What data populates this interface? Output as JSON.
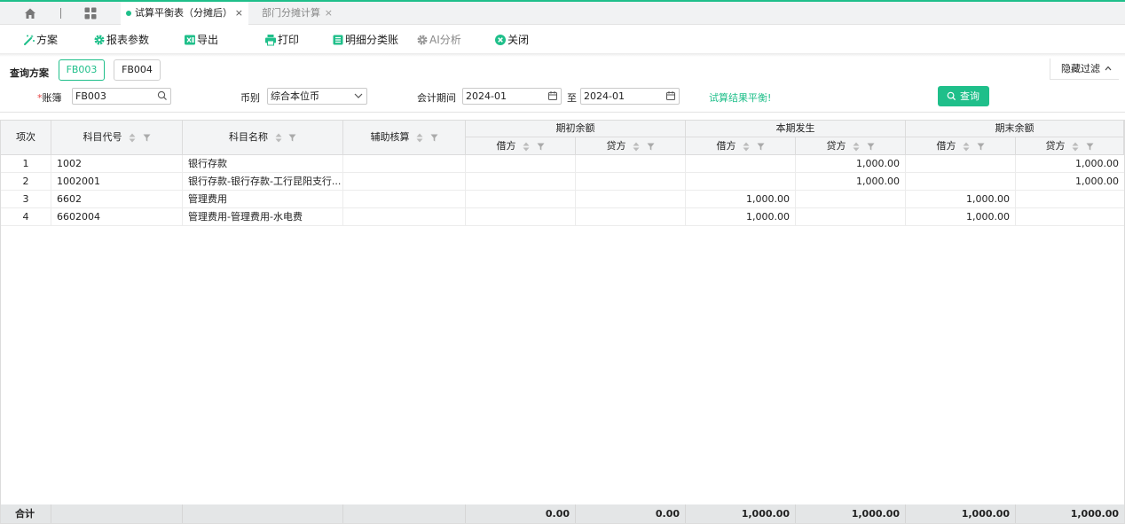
{
  "tabs": {
    "active_label": "试算平衡表（分摊后）",
    "inactive_label": "部门分摊计算",
    "close_glyph": "×"
  },
  "toolbar": {
    "scheme": "方案",
    "report_params": "报表参数",
    "export": "导出",
    "print": "打印",
    "detail_ledger": "明细分类账",
    "ai_analysis": "AI分析",
    "close": "关闭"
  },
  "query": {
    "label": "查询方案",
    "schemes": [
      "FB003",
      "FB004"
    ],
    "hide_filter": "隐藏过滤",
    "ledger_required_mark": "*",
    "ledger_label": "账簿",
    "ledger_value": "FB003",
    "currency_label": "币别",
    "currency_value": "综合本位币",
    "period_label": "会计期间",
    "period_from": "2024-01",
    "period_to_label": "至",
    "period_to": "2024-01",
    "balance_status": "试算结果平衡!",
    "query_button": "查询"
  },
  "colors": {
    "accent": "#1fbf8a",
    "required": "#e64545"
  },
  "table": {
    "headers": {
      "index": "项次",
      "code": "科目代号",
      "name": "科目名称",
      "aux": "辅助核算",
      "opening": "期初余额",
      "current": "本期发生",
      "closing": "期末余额",
      "debit": "借方",
      "credit": "贷方"
    },
    "rows": [
      {
        "idx": "1",
        "code": "1002",
        "name": "银行存款",
        "aux": "",
        "ob_d": "",
        "ob_c": "",
        "cur_d": "",
        "cur_c": "1,000.00",
        "cb_d": "",
        "cb_c": "1,000.00"
      },
      {
        "idx": "2",
        "code": "1002001",
        "name": "银行存款-银行存款-工行昆阳支行...",
        "aux": "",
        "ob_d": "",
        "ob_c": "",
        "cur_d": "",
        "cur_c": "1,000.00",
        "cb_d": "",
        "cb_c": "1,000.00"
      },
      {
        "idx": "3",
        "code": "6602",
        "name": "管理费用",
        "aux": "",
        "ob_d": "",
        "ob_c": "",
        "cur_d": "1,000.00",
        "cur_c": "",
        "cb_d": "1,000.00",
        "cb_c": ""
      },
      {
        "idx": "4",
        "code": "6602004",
        "name": "管理费用-管理费用-水电费",
        "aux": "",
        "ob_d": "",
        "ob_c": "",
        "cur_d": "1,000.00",
        "cur_c": "",
        "cb_d": "1,000.00",
        "cb_c": ""
      }
    ],
    "totals": {
      "label": "合计",
      "ob_d": "0.00",
      "ob_c": "0.00",
      "cur_d": "1,000.00",
      "cur_c": "1,000.00",
      "cb_d": "1,000.00",
      "cb_c": "1,000.00"
    }
  }
}
